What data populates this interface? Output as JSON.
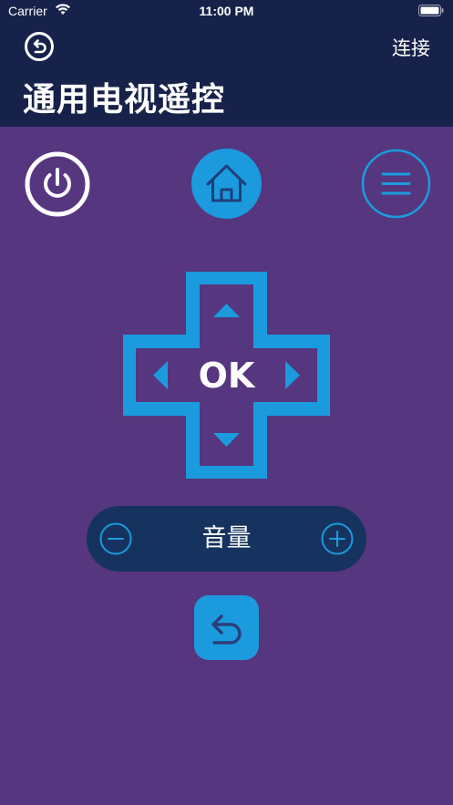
{
  "status_bar": {
    "carrier": "Carrier",
    "time": "11:00 PM"
  },
  "header": {
    "connect_label": "连接",
    "title": "通用电视遥控"
  },
  "dpad": {
    "ok_label": "OK"
  },
  "volume": {
    "label": "音量"
  },
  "colors": {
    "background": "#55367f",
    "header": "#17224a",
    "accent": "#1b9bde",
    "volume_bar": "#16335f"
  },
  "icons": {
    "back": "back-circle-icon",
    "power": "power-icon",
    "home": "home-icon",
    "menu": "menu-icon",
    "up": "arrow-up-icon",
    "down": "arrow-down-icon",
    "left": "arrow-left-icon",
    "right": "arrow-right-icon",
    "minus": "minus-icon",
    "plus": "plus-icon",
    "return": "return-icon"
  }
}
